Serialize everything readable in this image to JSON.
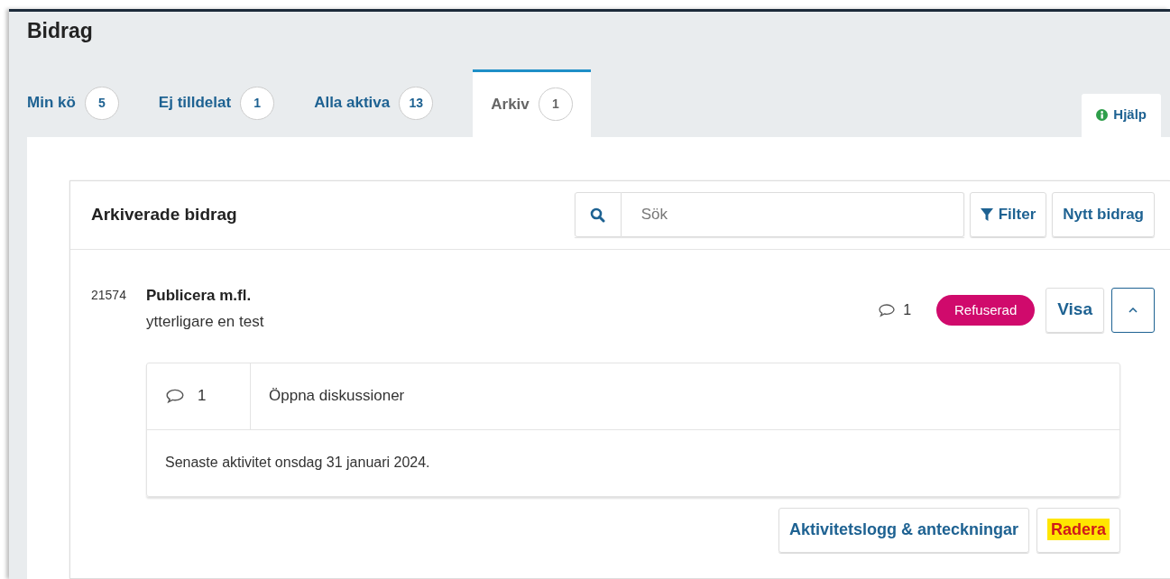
{
  "page_title": "Bidrag",
  "tabs": [
    {
      "label": "Min kö",
      "count": "5",
      "selected": false
    },
    {
      "label": "Ej tilldelat",
      "count": "1",
      "selected": false
    },
    {
      "label": "Alla aktiva",
      "count": "13",
      "selected": false
    },
    {
      "label": "Arkiv",
      "count": "1",
      "selected": true
    }
  ],
  "help": {
    "label": "Hjälp"
  },
  "panel": {
    "title": "Arkiverade bidrag",
    "search": {
      "placeholder": "Sök"
    },
    "buttons": [
      {
        "label": "Filter",
        "kind": "filter"
      },
      {
        "label": "Nytt bidrag",
        "kind": "plain"
      }
    ]
  },
  "submission": {
    "id": "21574",
    "authors": "Publicera m.fl.",
    "title": "ytterligare en test",
    "comments": "1",
    "status": "Refuserad",
    "view": "Visa",
    "expanded": true,
    "details": {
      "discussion_count": "1",
      "discussion_label": "Öppna diskussioner",
      "last_activity": "Senaste aktivitet onsdag 31 januari 2024."
    },
    "actions": [
      {
        "label": "Aktivitetslogg & anteckningar",
        "highlighted": false
      },
      {
        "label": "Radera",
        "highlighted": true
      }
    ]
  }
}
